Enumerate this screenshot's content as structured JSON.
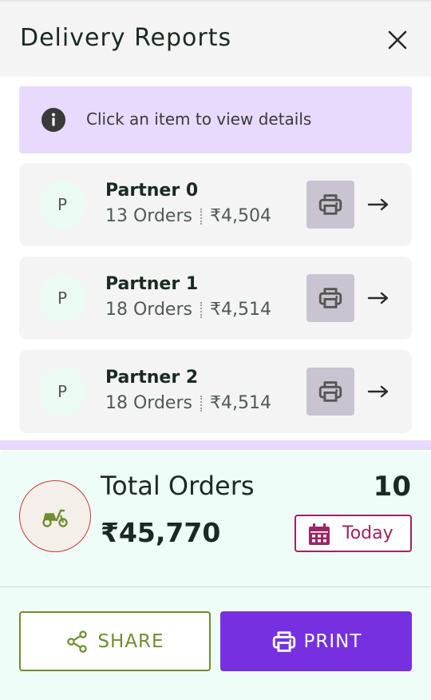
{
  "header": {
    "title": "Delivery Reports",
    "close_icon": "close-icon"
  },
  "info_banner": {
    "icon": "info-icon",
    "text": "Click an item to view details"
  },
  "partners": [
    {
      "avatar": "P",
      "name": "Partner 0",
      "orders": "13 Orders",
      "amount": "₹4,504"
    },
    {
      "avatar": "P",
      "name": "Partner 1",
      "orders": "18 Orders",
      "amount": "₹4,514"
    },
    {
      "avatar": "P",
      "name": "Partner 2",
      "orders": "18 Orders",
      "amount": "₹4,514"
    }
  ],
  "summary": {
    "icon": "scooter-icon",
    "label": "Total Orders",
    "count": "10",
    "amount": "₹45,770",
    "date_filter": "Today",
    "date_icon": "calendar-icon"
  },
  "actions": {
    "share_label": "SHARE",
    "print_label": "PRINT"
  },
  "colors": {
    "banner_bg": "#e7dafc",
    "summary_bg": "#effdf8",
    "print_button": "#7630e0",
    "share_accent": "#6e8e2f",
    "date_accent": "#9c2462",
    "card_bg": "#f4f4f4",
    "print_icon_bg": "#c9c4cf"
  }
}
